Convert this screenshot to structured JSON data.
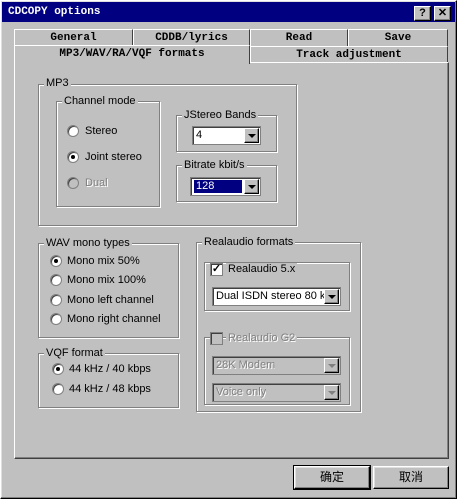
{
  "window": {
    "title": "CDCOPY options",
    "help_button": "?",
    "close_button": "✕"
  },
  "tabs": {
    "row1": [
      "General",
      "CDDB/lyrics",
      "Read",
      "Save"
    ],
    "row2": [
      "MP3/WAV/RA/VQF formats",
      "Track adjustment"
    ],
    "selected": "MP3/WAV/RA/VQF formats"
  },
  "mp3": {
    "group_label": "MP3",
    "channel_mode": {
      "label": "Channel mode",
      "options": [
        "Stereo",
        "Joint stereo",
        "Dual"
      ],
      "selected": "Joint stereo",
      "disabled": [
        "Dual"
      ]
    },
    "jstereo": {
      "label": "JStereo Bands",
      "value": "4"
    },
    "bitrate": {
      "label": "Bitrate kbit/s",
      "value": "128"
    }
  },
  "wav": {
    "label": "WAV mono types",
    "options": [
      "Mono mix 50%",
      "Mono mix 100%",
      "Mono left channel",
      "Mono right channel"
    ],
    "selected": "Mono mix 50%"
  },
  "vqf": {
    "label": "VQF format",
    "options": [
      "44 kHz / 40 kbps",
      "44 kHz / 48 kbps"
    ],
    "selected": "44 kHz / 40 kbps"
  },
  "realaudio": {
    "label": "Realaudio formats",
    "ra5": {
      "label": "Realaudio 5.x",
      "checked": true,
      "format": "Dual ISDN stereo 80 k"
    },
    "g2": {
      "label": "Realaudio G2",
      "checked": false,
      "enabled": false,
      "connection": "28K Modem",
      "type": "Voice only"
    }
  },
  "buttons": {
    "ok": "确定",
    "cancel": "取消"
  }
}
